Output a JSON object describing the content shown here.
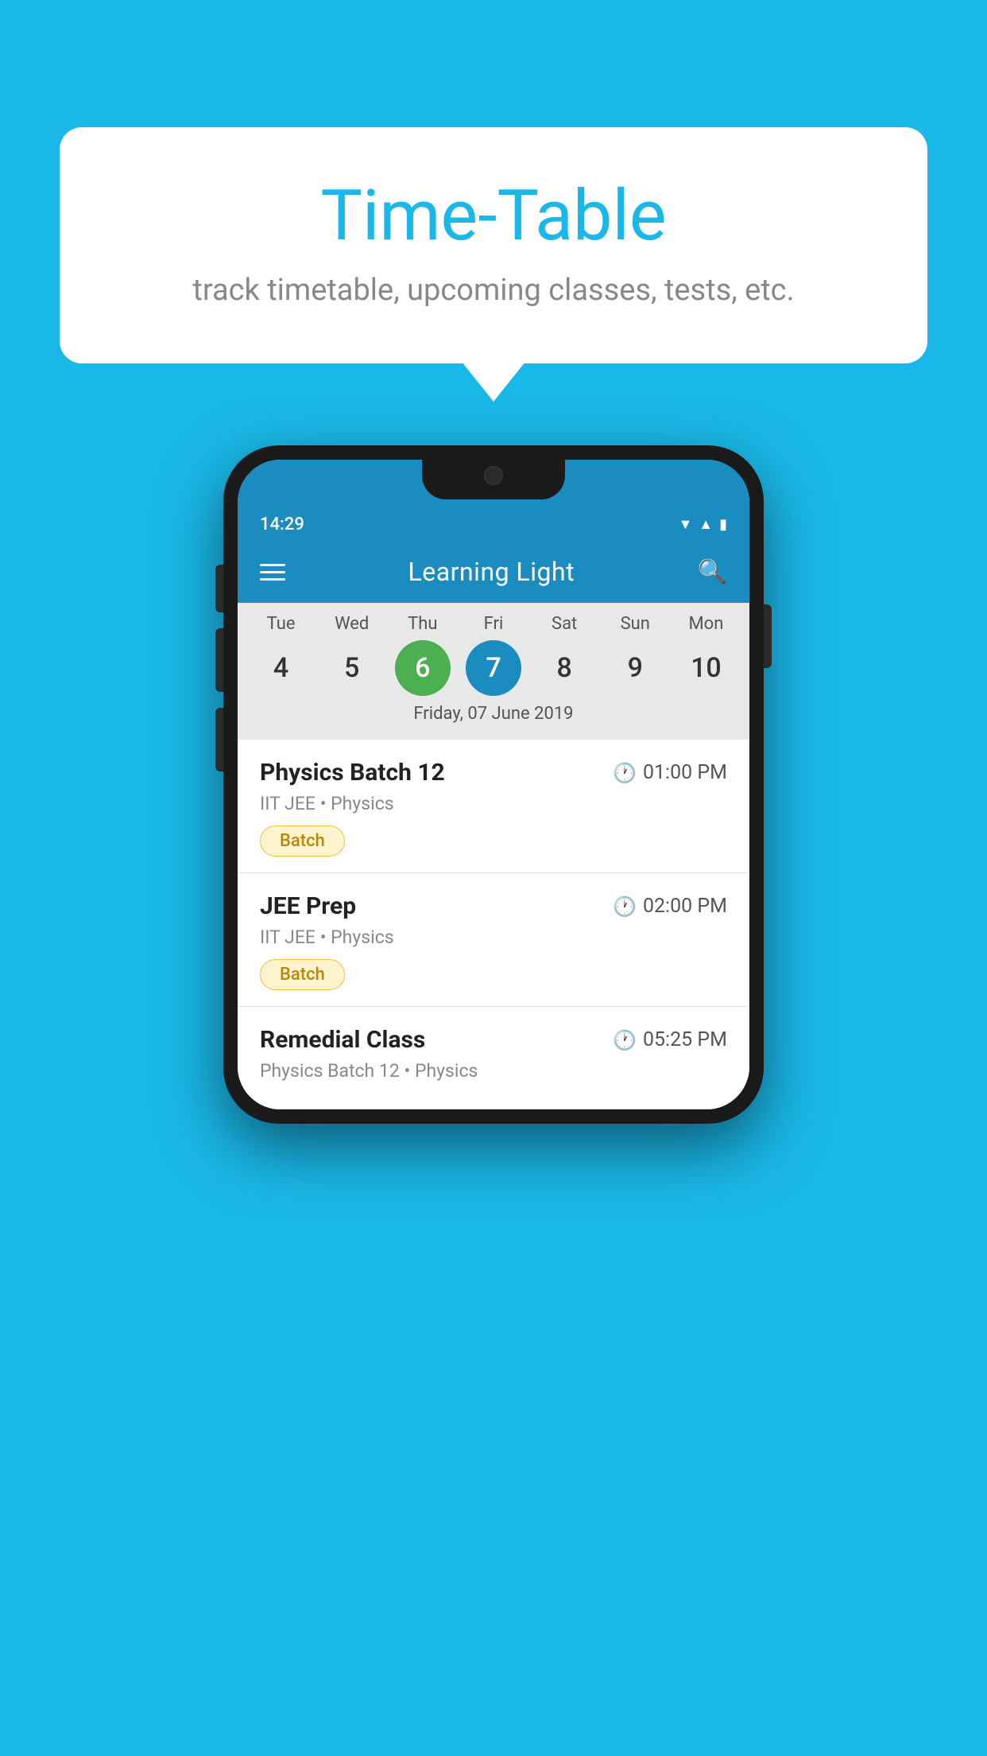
{
  "background_color": "#1ab8e8",
  "bubble": {
    "title": "Time-Table",
    "subtitle": "track timetable, upcoming classes, tests, etc."
  },
  "phone": {
    "status_bar": {
      "time": "14:29"
    },
    "app_bar": {
      "title": "Learning Light"
    },
    "calendar": {
      "days": [
        {
          "label": "Tue",
          "num": "4",
          "state": "normal"
        },
        {
          "label": "Wed",
          "num": "5",
          "state": "normal"
        },
        {
          "label": "Thu",
          "num": "6",
          "state": "today"
        },
        {
          "label": "Fri",
          "num": "7",
          "state": "selected"
        },
        {
          "label": "Sat",
          "num": "8",
          "state": "normal"
        },
        {
          "label": "Sun",
          "num": "9",
          "state": "normal"
        },
        {
          "label": "Mon",
          "num": "10",
          "state": "normal"
        }
      ],
      "selected_date_label": "Friday, 07 June 2019"
    },
    "classes": [
      {
        "name": "Physics Batch 12",
        "time": "01:00 PM",
        "meta": "IIT JEE • Physics",
        "badge": "Batch"
      },
      {
        "name": "JEE Prep",
        "time": "02:00 PM",
        "meta": "IIT JEE • Physics",
        "badge": "Batch"
      },
      {
        "name": "Remedial Class",
        "time": "05:25 PM",
        "meta": "Physics Batch 12 • Physics",
        "badge": null
      }
    ]
  }
}
